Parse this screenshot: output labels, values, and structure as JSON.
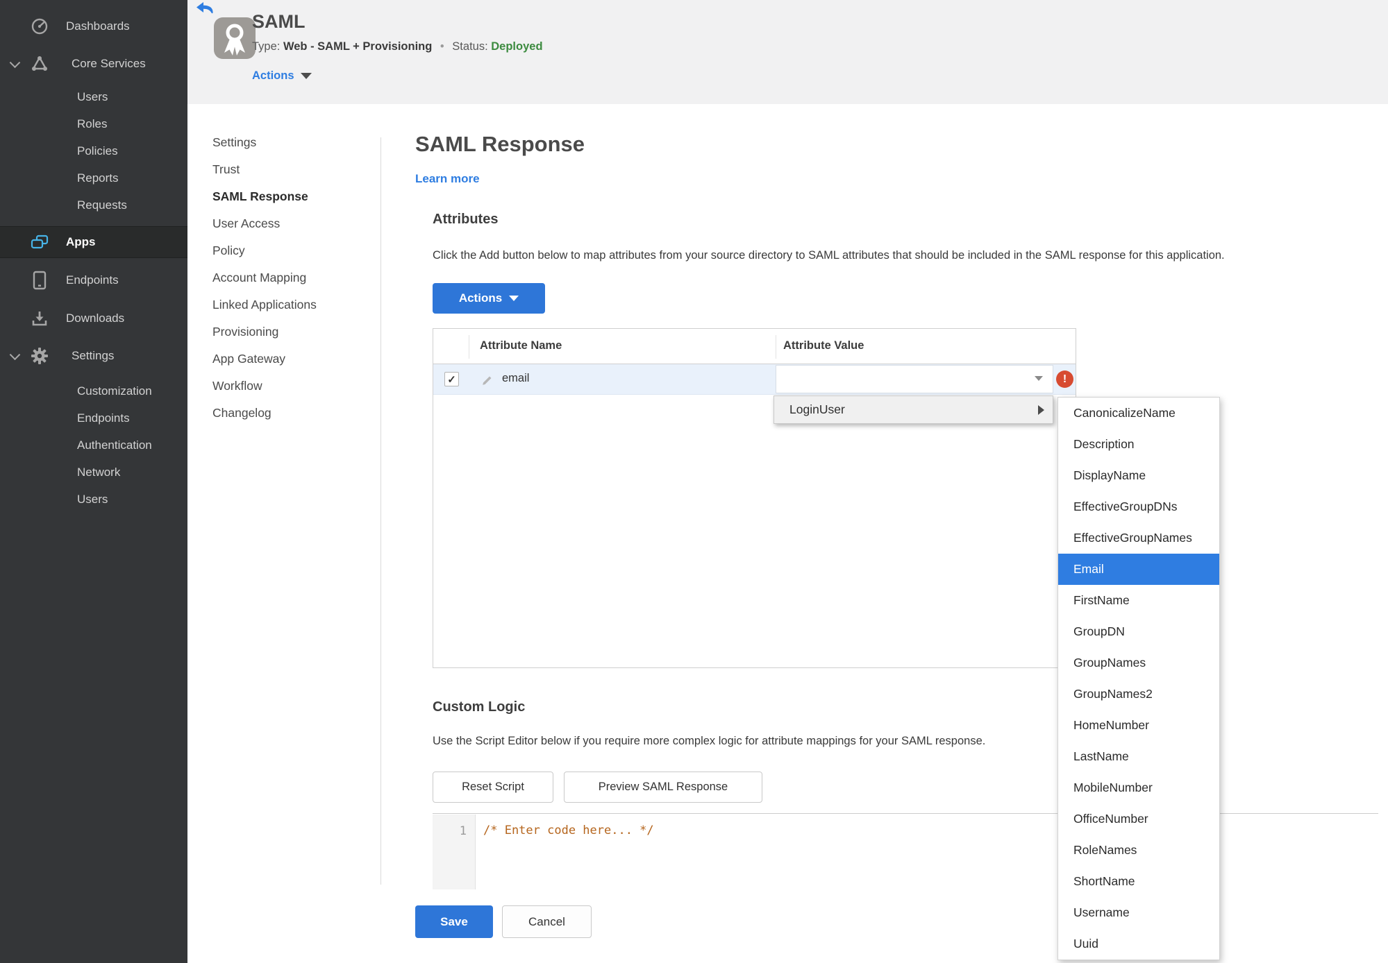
{
  "colors": {
    "accent_blue": "#2E7DE1",
    "button_blue": "#2E76D8",
    "status_green": "#3D8B40",
    "error_red": "#D74B31",
    "sidebar_cyan": "#47B4E8",
    "row_highlight": "#E9F1FB",
    "selected_option_blue": "#2F7DE1",
    "code_comment_orange": "#B5651D"
  },
  "sidebar": {
    "dashboards_label": "Dashboards",
    "core_services": {
      "label": "Core Services",
      "children": [
        "Users",
        "Roles",
        "Policies",
        "Reports",
        "Requests"
      ]
    },
    "apps_label": "Apps",
    "endpoints_label": "Endpoints",
    "downloads_label": "Downloads",
    "settings": {
      "label": "Settings",
      "children": [
        "Customization",
        "Endpoints",
        "Authentication",
        "Network",
        "Users"
      ]
    }
  },
  "header": {
    "title": "SAML",
    "type_label": "Type:",
    "type_value": "Web - SAML + Provisioning",
    "dot": "•",
    "status_label": "Status:",
    "status_value": "Deployed",
    "actions_label": "Actions"
  },
  "subnav": {
    "items": [
      {
        "label": "Settings"
      },
      {
        "label": "Trust"
      },
      {
        "label": "SAML Response",
        "active": true
      },
      {
        "label": "User Access"
      },
      {
        "label": "Policy"
      },
      {
        "label": "Account Mapping"
      },
      {
        "label": "Linked Applications"
      },
      {
        "label": "Provisioning"
      },
      {
        "label": "App Gateway"
      },
      {
        "label": "Workflow"
      },
      {
        "label": "Changelog"
      }
    ]
  },
  "main": {
    "title": "SAML Response",
    "learn_more": "Learn more",
    "attributes": {
      "heading": "Attributes",
      "description": "Click the Add button below to map attributes from your source directory to SAML attributes that should be included in the SAML response for this application.",
      "actions_button": "Actions",
      "table": {
        "columns": [
          "Attribute Name",
          "Attribute Value"
        ],
        "check_glyph": "✓",
        "error_glyph": "!",
        "rows": [
          {
            "name": "email",
            "value": "",
            "checked": true
          }
        ]
      }
    },
    "custom_logic": {
      "heading": "Custom Logic",
      "description": "Use the Script Editor below if you require more complex logic for attribute mappings for your SAML response.",
      "reset_button": "Reset Script",
      "preview_button": "Preview SAML Response",
      "editor": {
        "line_number": "1",
        "code": "/* Enter code here... */"
      }
    },
    "save_button": "Save",
    "cancel_button": "Cancel"
  },
  "value_menu": {
    "parent_item": "LoginUser",
    "options": [
      {
        "label": "CanonicalizeName"
      },
      {
        "label": "Description"
      },
      {
        "label": "DisplayName"
      },
      {
        "label": "EffectiveGroupDNs"
      },
      {
        "label": "EffectiveGroupNames"
      },
      {
        "label": "Email",
        "selected": true
      },
      {
        "label": "FirstName"
      },
      {
        "label": "GroupDN"
      },
      {
        "label": "GroupNames"
      },
      {
        "label": "GroupNames2"
      },
      {
        "label": "HomeNumber"
      },
      {
        "label": "LastName"
      },
      {
        "label": "MobileNumber"
      },
      {
        "label": "OfficeNumber"
      },
      {
        "label": "RoleNames"
      },
      {
        "label": "ShortName"
      },
      {
        "label": "Username"
      },
      {
        "label": "Uuid"
      }
    ]
  }
}
